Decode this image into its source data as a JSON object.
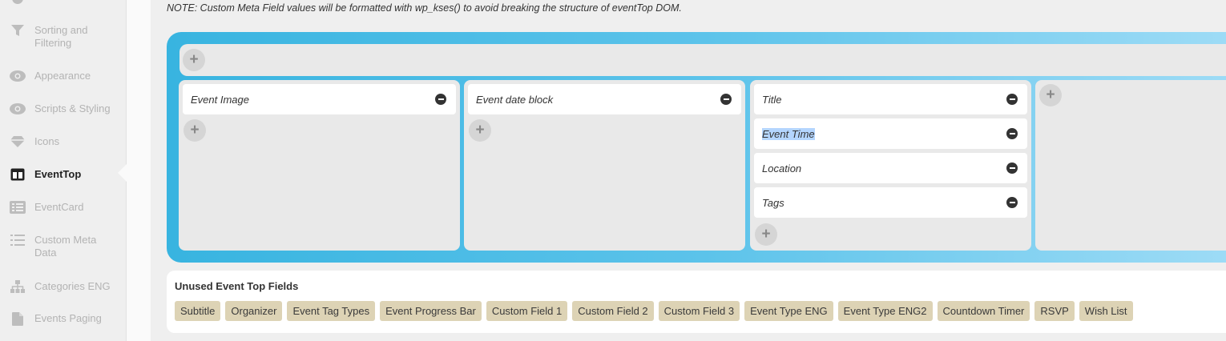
{
  "sidebar": {
    "items": [
      {
        "label": "Sorting and Filtering",
        "icon": "filter-icon"
      },
      {
        "label": "Appearance",
        "icon": "eye-icon"
      },
      {
        "label": "Scripts & Styling",
        "icon": "eye-icon"
      },
      {
        "label": "Icons",
        "icon": "gem-icon"
      },
      {
        "label": "EventTop",
        "icon": "layout-icon",
        "active": true
      },
      {
        "label": "EventCard",
        "icon": "card-list-icon"
      },
      {
        "label": "Custom Meta Data",
        "icon": "list-icon"
      },
      {
        "label": "Categories ENG",
        "icon": "sitemap-icon"
      },
      {
        "label": "Events Paging",
        "icon": "file-icon"
      }
    ]
  },
  "main": {
    "note": "NOTE: Custom Meta Field values will be formatted with wp_kses() to avoid breaking the structure of eventTop DOM.",
    "add_symbol": "+",
    "columns": [
      {
        "fields": [
          "Event Image"
        ]
      },
      {
        "fields": [
          "Event date block"
        ]
      },
      {
        "fields": [
          "Title",
          "Event Time",
          "Location",
          "Tags"
        ],
        "selected": "Event Time"
      },
      {
        "fields": []
      }
    ],
    "unused": {
      "title": "Unused Event Top Fields",
      "fields": [
        "Subtitle",
        "Organizer",
        "Event Tag Types",
        "Event Progress Bar",
        "Custom Field 1",
        "Custom Field 2",
        "Custom Field 3",
        "Event Type ENG",
        "Event Type ENG2",
        "Countdown Timer",
        "RSVP",
        "Wish List"
      ]
    }
  },
  "colors": {
    "frame_gradient_start": "#38b4e0",
    "frame_gradient_end": "#9fdcf6",
    "tag_bg": "#ddd3b5",
    "selection": "#b4d5fe"
  }
}
